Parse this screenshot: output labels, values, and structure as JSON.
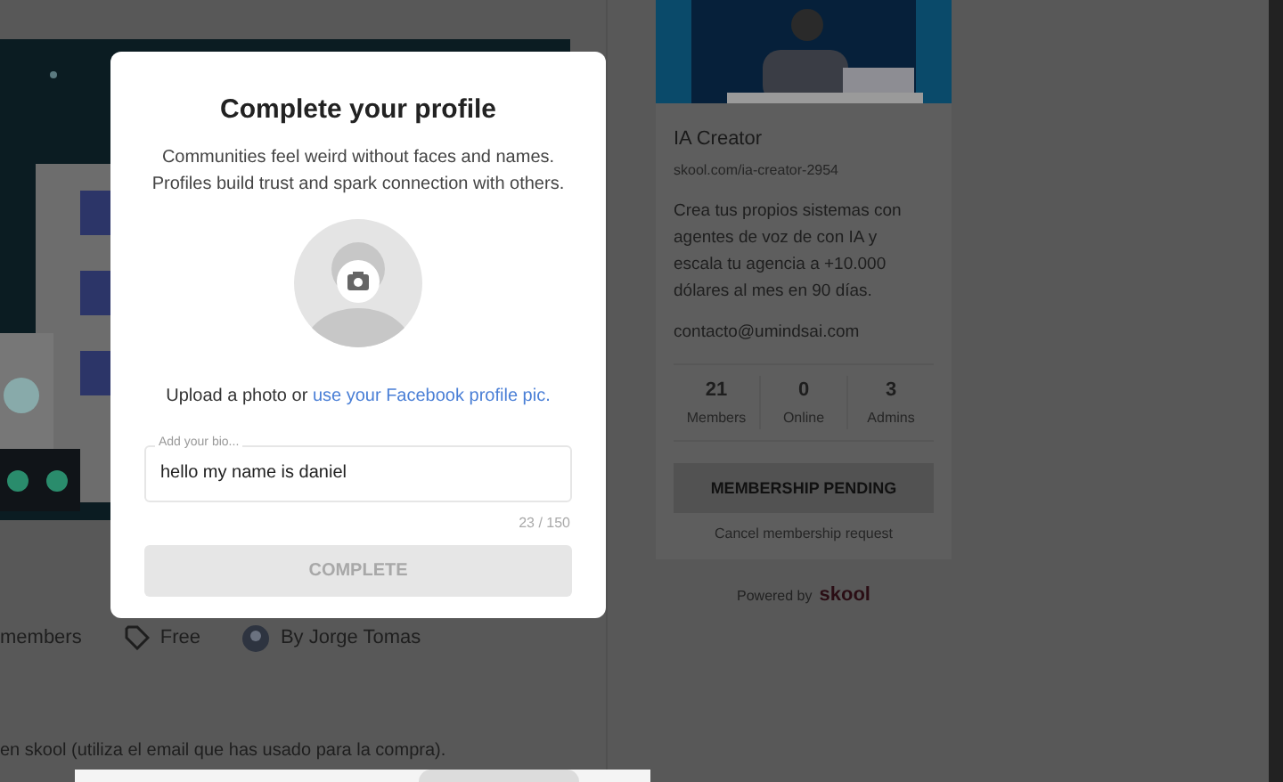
{
  "page": {
    "meta": [
      {
        "kind": "members",
        "label": "members"
      },
      {
        "kind": "price",
        "label": "Free"
      },
      {
        "kind": "author",
        "label": "By Jorge Tomas"
      }
    ],
    "note": "en skool (utiliza el email que has usado para la compra)."
  },
  "group_card": {
    "name": "IA Creator",
    "url": "skool.com/ia-creator-2954",
    "description": "Crea tus propios sistemas con agentes de voz de con IA y escala tu agencia a +10.000 dólares al mes en 90 días.",
    "email": "contacto@umindsai.com",
    "stats": [
      {
        "value": "21",
        "label": "Members"
      },
      {
        "value": "0",
        "label": "Online"
      },
      {
        "value": "3",
        "label": "Admins"
      }
    ],
    "button": "MEMBERSHIP PENDING",
    "cancel_link": "Cancel membership request",
    "powered_by": "Powered by",
    "brand": "skool"
  },
  "modal": {
    "title": "Complete your profile",
    "subtitle": "Communities feel weird without faces and names. Profiles build trust and spark connection with others.",
    "upload_text": "Upload a photo or",
    "upload_link": "use your Facebook profile pic.",
    "bio": {
      "label": "Add your bio...",
      "value": "hello my name is daniel",
      "counter": "23 / 150"
    },
    "button": {
      "label": "COMPLETE",
      "disabled": true
    }
  }
}
